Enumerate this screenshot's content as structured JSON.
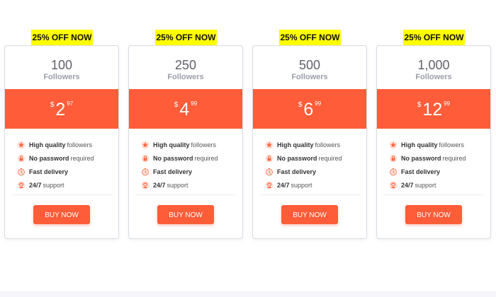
{
  "colors": {
    "accent": "#ff5c39",
    "badge": "#ffff00",
    "icon": "#ff6a48"
  },
  "plans": [
    {
      "badge": "25% OFF NOW",
      "quantity": "100",
      "unit": "Followers",
      "currency": "$",
      "price": "2",
      "cents": "97",
      "features": [
        {
          "bold": "High quality",
          "rest": "followers",
          "icon": "star-icon"
        },
        {
          "bold": "No password",
          "rest": "required",
          "icon": "lock-icon"
        },
        {
          "bold": "Fast delivery",
          "rest": "",
          "icon": "stopwatch-icon"
        },
        {
          "bold": "24/7",
          "rest": "support",
          "icon": "support-agent-icon"
        }
      ],
      "button": "BUY NOW"
    },
    {
      "badge": "25% OFF NOW",
      "quantity": "250",
      "unit": "Followers",
      "currency": "$",
      "price": "4",
      "cents": "99",
      "features": [
        {
          "bold": "High quality",
          "rest": "followers",
          "icon": "star-icon"
        },
        {
          "bold": "No password",
          "rest": "required",
          "icon": "lock-icon"
        },
        {
          "bold": "Fast delivery",
          "rest": "",
          "icon": "stopwatch-icon"
        },
        {
          "bold": "24/7",
          "rest": "support",
          "icon": "support-agent-icon"
        }
      ],
      "button": "BUY NOW"
    },
    {
      "badge": "25% OFF NOW",
      "quantity": "500",
      "unit": "Followers",
      "currency": "$",
      "price": "6",
      "cents": "99",
      "features": [
        {
          "bold": "High quality",
          "rest": "followers",
          "icon": "star-icon"
        },
        {
          "bold": "No password",
          "rest": "required",
          "icon": "lock-icon"
        },
        {
          "bold": "Fast delivery",
          "rest": "",
          "icon": "stopwatch-icon"
        },
        {
          "bold": "24/7",
          "rest": "support",
          "icon": "support-agent-icon"
        }
      ],
      "button": "BUY NOW"
    },
    {
      "badge": "25% OFF NOW",
      "quantity": "1,000",
      "unit": "Followers",
      "currency": "$",
      "price": "12",
      "cents": "99",
      "features": [
        {
          "bold": "High quality",
          "rest": "followers",
          "icon": "star-icon"
        },
        {
          "bold": "No password",
          "rest": "required",
          "icon": "lock-icon"
        },
        {
          "bold": "Fast delivery",
          "rest": "",
          "icon": "stopwatch-icon"
        },
        {
          "bold": "24/7",
          "rest": "support",
          "icon": "support-agent-icon"
        }
      ],
      "button": "BUY NOW"
    }
  ]
}
